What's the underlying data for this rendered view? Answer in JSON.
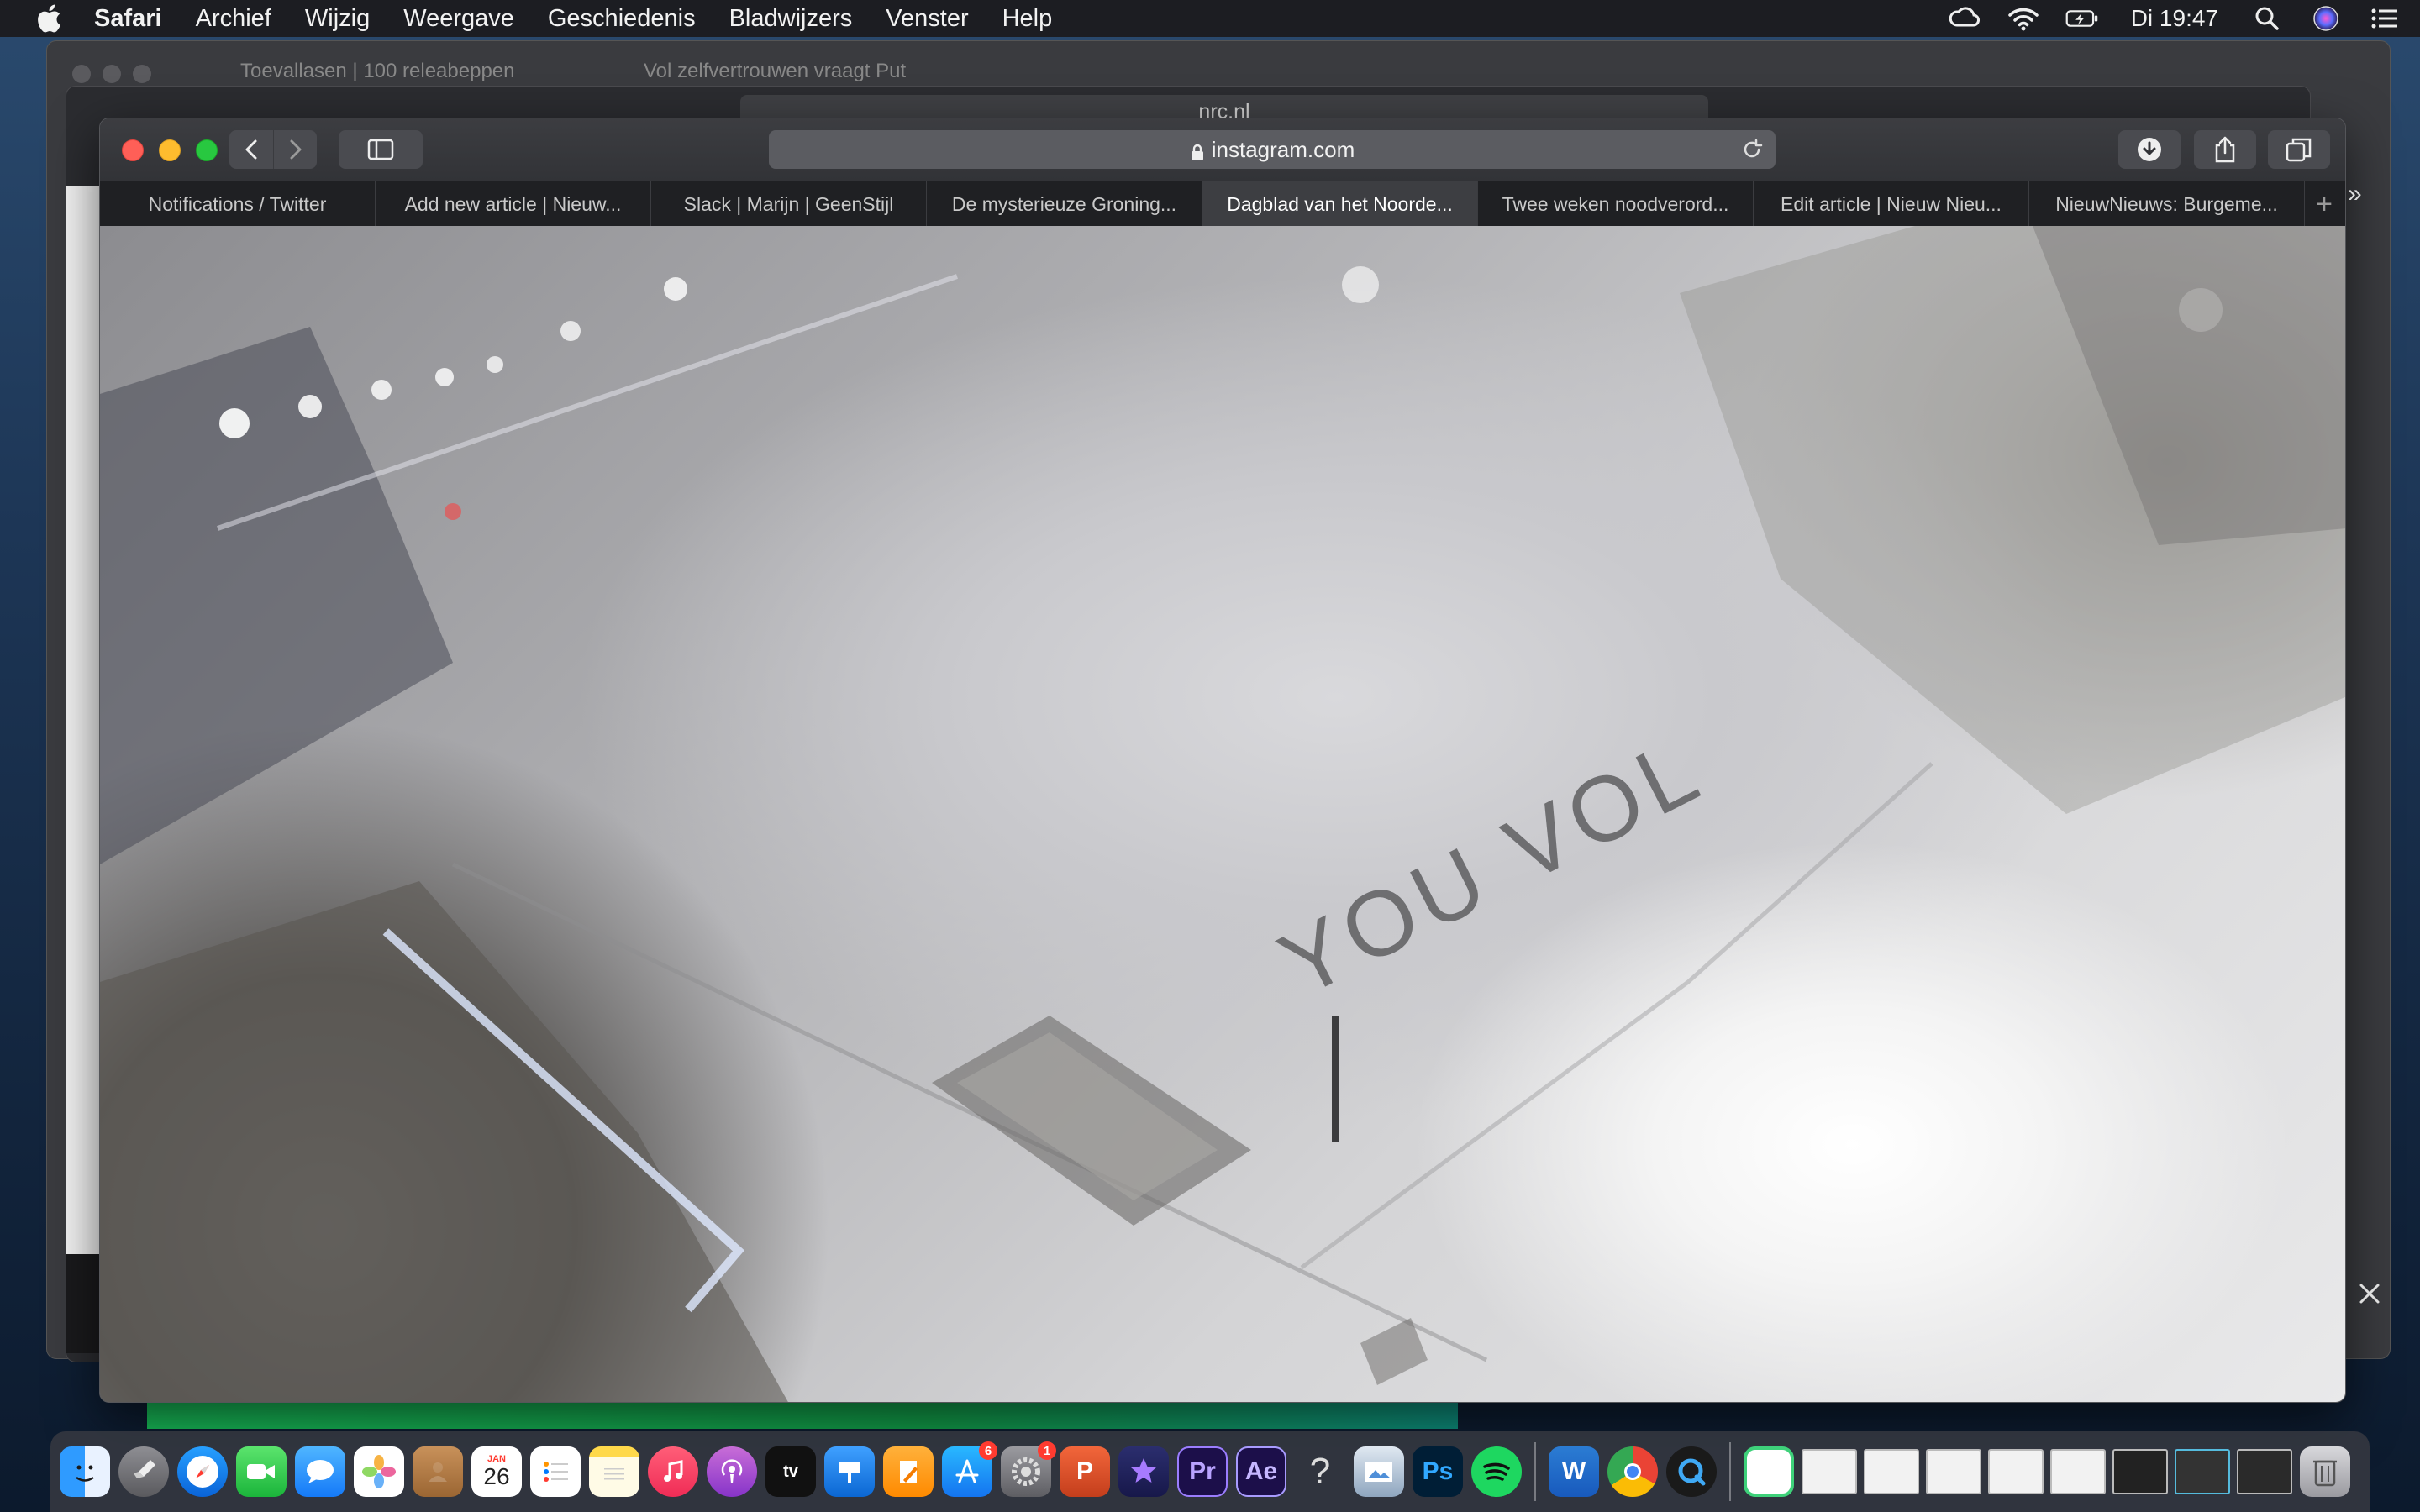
{
  "menubar": {
    "app_name": "Safari",
    "items": [
      "Archief",
      "Wijzig",
      "Weergave",
      "Geschiedenis",
      "Bladwijzers",
      "Venster",
      "Help"
    ],
    "clock": "Di 19:47"
  },
  "background_windows": {
    "tab_1": "Toevallasen | 100 releabeppen",
    "tab_2": "Vol zelfvertrouwen vraagt Put",
    "address": "nrc.nl"
  },
  "safari": {
    "address": "instagram.com",
    "tabs": [
      {
        "label": "Notifications / Twitter",
        "active": false
      },
      {
        "label": "Add new article | Nieuw...",
        "active": false
      },
      {
        "label": "Slack | Marijn | GeenStijl",
        "active": false
      },
      {
        "label": "De mysterieuze Groning...",
        "active": false
      },
      {
        "label": "Dagblad van het Noorde...",
        "active": true
      },
      {
        "label": "Twee weken noodverord...",
        "active": false
      },
      {
        "label": "Edit article | Nieuw Nieu...",
        "active": false
      },
      {
        "label": "NieuwNieuws: Burgeme...",
        "active": false
      }
    ],
    "new_tab_symbol": "+",
    "overflow_symbol": "»"
  },
  "video": {
    "snow_text": "YOU VOL"
  },
  "dock": {
    "calendar_month": "JAN",
    "calendar_day": "26",
    "appstore_badge": "6",
    "prefs_badge": "1",
    "labels": {
      "premiere": "Pr",
      "aftereffects": "Ae",
      "photoshop": "Ps",
      "word": "W",
      "powerpoint": "P",
      "help": "?",
      "tv": "tv"
    }
  },
  "colors": {
    "menubar_bg": "#1c1d22",
    "active_tab_bg": "#3d3e42",
    "close": "#ff5f57",
    "minimize": "#febc2e",
    "maximize": "#28c840"
  }
}
